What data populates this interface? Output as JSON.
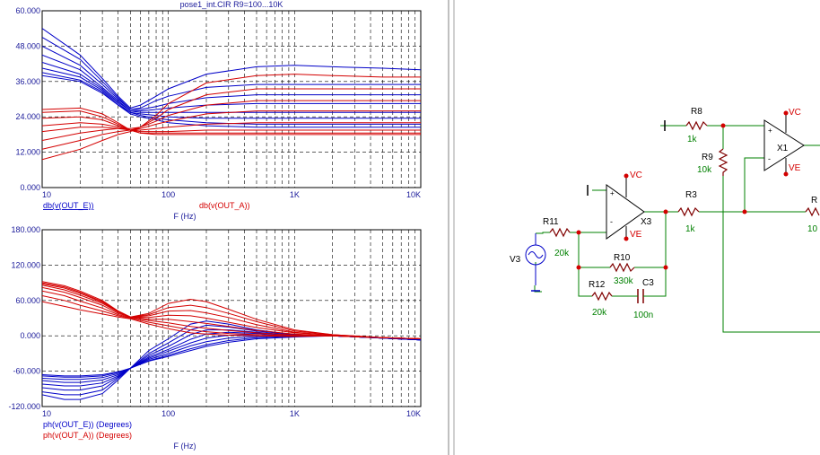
{
  "plot_title": "pose1_int.CIR R9=100...10K",
  "colors": {
    "series_a": "#d40000",
    "series_e": "#0000c8",
    "axis_text": "#1a1a9a",
    "grid": "#000000",
    "wire": "#008000",
    "component": "#800000",
    "node": "#d40000",
    "comp_label": "#000000",
    "value_label": "#008000",
    "rail": "#d40000",
    "source": "#0000c8",
    "divider": "#808080"
  },
  "chart_data": [
    {
      "type": "line",
      "x_scale": "log",
      "xlim": [
        10,
        10000
      ],
      "ylim": [
        0,
        60
      ],
      "grid": true,
      "xticks": [
        "10",
        "100",
        "1K",
        "10K"
      ],
      "yticks": [
        "60.000",
        "48.000",
        "36.000",
        "24.000",
        "12.000",
        "0.000"
      ],
      "xlabel": "F (Hz)",
      "legend": [
        "db(v(OUT_E))",
        "db(v(OUT_A))"
      ],
      "x": [
        10,
        20,
        30,
        40,
        50,
        60,
        80,
        100,
        200,
        500,
        1000,
        2000,
        5000,
        10000
      ],
      "series": [
        {
          "name": "db(v(OUT_E))",
          "values": [
            54.0,
            45.0,
            37.0,
            31.0,
            27.0,
            28.0,
            31.0,
            33.5,
            38.5,
            41.0,
            41.5,
            41.0,
            40.5,
            40.0
          ]
        },
        {
          "name": "db(v(OUT_E))",
          "values": [
            51.0,
            43.5,
            36.0,
            30.5,
            26.5,
            27.0,
            29.5,
            31.0,
            34.0,
            35.0,
            35.0,
            35.0,
            35.0,
            35.0
          ]
        },
        {
          "name": "db(v(OUT_E))",
          "values": [
            48.0,
            41.5,
            35.0,
            30.0,
            26.5,
            26.5,
            27.5,
            28.5,
            30.5,
            31.5,
            31.5,
            31.5,
            31.5,
            31.5
          ]
        },
        {
          "name": "db(v(OUT_E))",
          "values": [
            45.0,
            40.0,
            34.0,
            29.5,
            26.0,
            26.0,
            26.5,
            27.0,
            28.0,
            28.5,
            28.5,
            28.5,
            28.5,
            28.5
          ]
        },
        {
          "name": "db(v(OUT_E))",
          "values": [
            42.5,
            38.5,
            33.5,
            29.0,
            26.0,
            25.5,
            25.5,
            25.5,
            25.5,
            25.5,
            25.5,
            25.5,
            25.5,
            25.5
          ]
        },
        {
          "name": "db(v(OUT_E))",
          "values": [
            40.5,
            37.5,
            33.0,
            28.5,
            25.5,
            25.0,
            24.5,
            24.0,
            23.5,
            23.5,
            23.5,
            23.5,
            23.5,
            23.5
          ]
        },
        {
          "name": "db(v(OUT_E))",
          "values": [
            39.0,
            36.5,
            32.5,
            28.0,
            25.5,
            24.5,
            23.5,
            23.0,
            22.0,
            21.5,
            21.5,
            21.5,
            21.5,
            21.5
          ]
        },
        {
          "name": "db(v(OUT_E))",
          "values": [
            38.0,
            36.0,
            32.0,
            28.0,
            25.0,
            24.0,
            23.0,
            22.0,
            21.0,
            20.5,
            20.5,
            20.5,
            20.5,
            20.5
          ]
        },
        {
          "name": "db(v(OUT_A))",
          "values": [
            9.5,
            13.0,
            16.0,
            18.0,
            19.0,
            20.5,
            24.5,
            28.5,
            35.5,
            38.0,
            38.5,
            38.0,
            37.5,
            37.5
          ]
        },
        {
          "name": "db(v(OUT_A))",
          "values": [
            13.0,
            16.0,
            18.0,
            19.0,
            19.5,
            20.5,
            23.5,
            26.5,
            31.5,
            33.5,
            33.5,
            33.5,
            33.5,
            33.5
          ]
        },
        {
          "name": "db(v(OUT_A))",
          "values": [
            16.0,
            18.5,
            19.5,
            20.0,
            20.0,
            20.5,
            22.5,
            24.5,
            28.0,
            29.5,
            29.5,
            29.5,
            29.5,
            29.5
          ]
        },
        {
          "name": "db(v(OUT_A))",
          "values": [
            19.0,
            20.5,
            20.5,
            20.0,
            19.5,
            20.0,
            21.5,
            22.5,
            25.0,
            26.0,
            26.0,
            26.0,
            26.0,
            26.0
          ]
        },
        {
          "name": "db(v(OUT_A))",
          "values": [
            21.0,
            22.0,
            21.5,
            20.5,
            19.5,
            19.5,
            20.0,
            20.5,
            21.5,
            22.0,
            22.0,
            22.0,
            22.0,
            22.0
          ]
        },
        {
          "name": "db(v(OUT_A))",
          "values": [
            23.5,
            24.0,
            23.0,
            21.0,
            19.5,
            19.0,
            19.0,
            19.0,
            19.5,
            19.5,
            19.5,
            19.5,
            19.5,
            19.5
          ]
        },
        {
          "name": "db(v(OUT_A))",
          "values": [
            25.5,
            26.0,
            24.0,
            21.5,
            19.5,
            18.5,
            18.5,
            18.5,
            18.5,
            18.5,
            18.5,
            18.5,
            18.5,
            18.5
          ]
        },
        {
          "name": "db(v(OUT_A))",
          "values": [
            26.5,
            27.0,
            25.0,
            22.0,
            19.5,
            18.5,
            18.0,
            18.0,
            18.0,
            18.0,
            18.0,
            18.0,
            18.0,
            18.0
          ]
        }
      ]
    },
    {
      "type": "line",
      "x_scale": "log",
      "xlim": [
        10,
        10000
      ],
      "ylim": [
        -120,
        180
      ],
      "grid": true,
      "xticks": [
        "10",
        "100",
        "1K",
        "10K"
      ],
      "yticks": [
        "180.000",
        "120.000",
        "60.000",
        "0.000",
        "-60.000",
        "-120.000"
      ],
      "xlabel": "F (Hz)",
      "legend": [
        "ph(v(OUT_E)) (Degrees)",
        "ph(v(OUT_A)) (Degrees)"
      ],
      "x": [
        10,
        15,
        20,
        30,
        40,
        50,
        70,
        100,
        150,
        200,
        300,
        500,
        1000,
        2000,
        5000,
        10000
      ],
      "series": [
        {
          "name": "ph(v(OUT_E)) (Degrees)",
          "values": [
            -100,
            -108,
            -108,
            -98,
            -75,
            -55,
            -25,
            -5,
            20,
            25,
            20,
            10,
            2,
            0,
            -4,
            -7
          ]
        },
        {
          "name": "ph(v(OUT_E)) (Degrees)",
          "values": [
            -95,
            -100,
            -100,
            -92,
            -72,
            -55,
            -30,
            -12,
            10,
            18,
            15,
            8,
            2,
            0,
            -4,
            -7
          ]
        },
        {
          "name": "ph(v(OUT_E)) (Degrees)",
          "values": [
            -88,
            -92,
            -92,
            -85,
            -70,
            -55,
            -33,
            -18,
            2,
            10,
            10,
            6,
            1,
            0,
            -4,
            -7
          ]
        },
        {
          "name": "ph(v(OUT_E)) (Degrees)",
          "values": [
            -82,
            -85,
            -85,
            -80,
            -68,
            -55,
            -36,
            -23,
            -6,
            3,
            6,
            4,
            1,
            0,
            -4,
            -7
          ]
        },
        {
          "name": "ph(v(OUT_E)) (Degrees)",
          "values": [
            -76,
            -79,
            -79,
            -75,
            -66,
            -55,
            -38,
            -26,
            -12,
            -4,
            1,
            2,
            0,
            0,
            -4,
            -7
          ]
        },
        {
          "name": "ph(v(OUT_E)) (Degrees)",
          "values": [
            -72,
            -74,
            -74,
            -71,
            -64,
            -55,
            -40,
            -30,
            -17,
            -10,
            -4,
            -1,
            0,
            0,
            -4,
            -7
          ]
        },
        {
          "name": "ph(v(OUT_E)) (Degrees)",
          "values": [
            -68,
            -70,
            -70,
            -68,
            -62,
            -55,
            -42,
            -33,
            -22,
            -15,
            -8,
            -3,
            -1,
            0,
            -4,
            -7
          ]
        },
        {
          "name": "ph(v(OUT_E)) (Degrees)",
          "values": [
            -66,
            -68,
            -68,
            -66,
            -61,
            -55,
            -43,
            -35,
            -25,
            -18,
            -11,
            -5,
            -2,
            0,
            -4,
            -7
          ]
        },
        {
          "name": "ph(v(OUT_A)) (Degrees)",
          "values": [
            92,
            85,
            76,
            60,
            42,
            32,
            38,
            55,
            62,
            58,
            45,
            28,
            10,
            2,
            -3,
            -5
          ]
        },
        {
          "name": "ph(v(OUT_A)) (Degrees)",
          "values": [
            90,
            83,
            74,
            58,
            42,
            32,
            36,
            48,
            52,
            48,
            38,
            24,
            8,
            2,
            -3,
            -5
          ]
        },
        {
          "name": "ph(v(OUT_A)) (Degrees)",
          "values": [
            88,
            81,
            72,
            57,
            41,
            32,
            34,
            42,
            43,
            39,
            31,
            19,
            6,
            1,
            -3,
            -5
          ]
        },
        {
          "name": "ph(v(OUT_A)) (Degrees)",
          "values": [
            86,
            78,
            69,
            55,
            40,
            32,
            31,
            35,
            34,
            30,
            23,
            14,
            5,
            1,
            -3,
            -5
          ]
        },
        {
          "name": "ph(v(OUT_A)) (Degrees)",
          "values": [
            82,
            74,
            65,
            52,
            38,
            32,
            28,
            28,
            24,
            21,
            16,
            9,
            3,
            0,
            -3,
            -5
          ]
        },
        {
          "name": "ph(v(OUT_A)) (Degrees)",
          "values": [
            76,
            68,
            59,
            47,
            36,
            31,
            26,
            22,
            16,
            13,
            9,
            5,
            1,
            0,
            -3,
            -5
          ]
        },
        {
          "name": "ph(v(OUT_A)) (Degrees)",
          "values": [
            68,
            60,
            52,
            42,
            34,
            30,
            23,
            17,
            10,
            7,
            4,
            2,
            0,
            0,
            -3,
            -5
          ]
        },
        {
          "name": "ph(v(OUT_A)) (Degrees)",
          "values": [
            58,
            50,
            44,
            37,
            32,
            29,
            20,
            12,
            5,
            3,
            1,
            0,
            -1,
            0,
            -3,
            -5
          ]
        }
      ]
    }
  ],
  "schematic": {
    "rail_vc": "VC",
    "rail_ve": "VE",
    "components": {
      "r8": {
        "ref": "R8",
        "value": "1k"
      },
      "r9": {
        "ref": "R9",
        "value": "10k"
      },
      "x1": {
        "ref": "X1"
      },
      "r3": {
        "ref": "R3",
        "value": "1k"
      },
      "x3": {
        "ref": "X3"
      },
      "r11": {
        "ref": "R11",
        "value": "20k"
      },
      "v3": {
        "ref": "V3"
      },
      "r10": {
        "ref": "R10",
        "value": "330k"
      },
      "r12": {
        "ref": "R12",
        "value": "20k"
      },
      "c3": {
        "ref": "C3",
        "value": "100n"
      },
      "r_partial": {
        "ref": "R",
        "value": "10"
      }
    }
  }
}
